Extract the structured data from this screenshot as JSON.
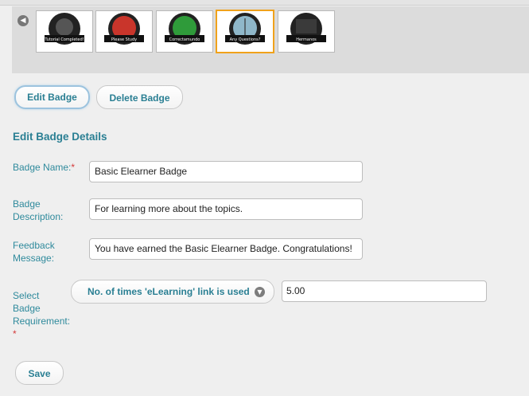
{
  "carousel": {
    "prev_icon": "chevron-left-icon",
    "badges": [
      {
        "caption": "Tutorial Completed!",
        "color": "#222222",
        "selected": false
      },
      {
        "caption": "Please Study",
        "color": "#c9352b",
        "selected": false
      },
      {
        "caption": "Correctamundo",
        "color": "#2f9b3a",
        "selected": false
      },
      {
        "caption": "Any Questions?",
        "color": "#8fb7c9",
        "selected": true
      },
      {
        "caption": "Hermanos",
        "color": "#3a3a3a",
        "selected": false
      }
    ]
  },
  "actions": {
    "edit_label": "Edit Badge",
    "delete_label": "Delete Badge"
  },
  "form": {
    "title": "Edit Badge Details",
    "name_label": "Badge Name:",
    "name_value": "Basic Elearner Badge",
    "desc_label_1": "Badge",
    "desc_label_2": "Description:",
    "desc_value": "For learning more about the topics.",
    "feedback_label_1": "Feedback",
    "feedback_label_2": "Message:",
    "feedback_value": "You have earned the Basic Elearner Badge. Congratulations!",
    "req_label_1": "Select",
    "req_label_2": "Badge",
    "req_label_3": "Requirement:",
    "required_mark": "*",
    "requirement_selected": "No. of times 'eLearning' link is used",
    "requirement_value": "5.00",
    "save_label": "Save"
  }
}
